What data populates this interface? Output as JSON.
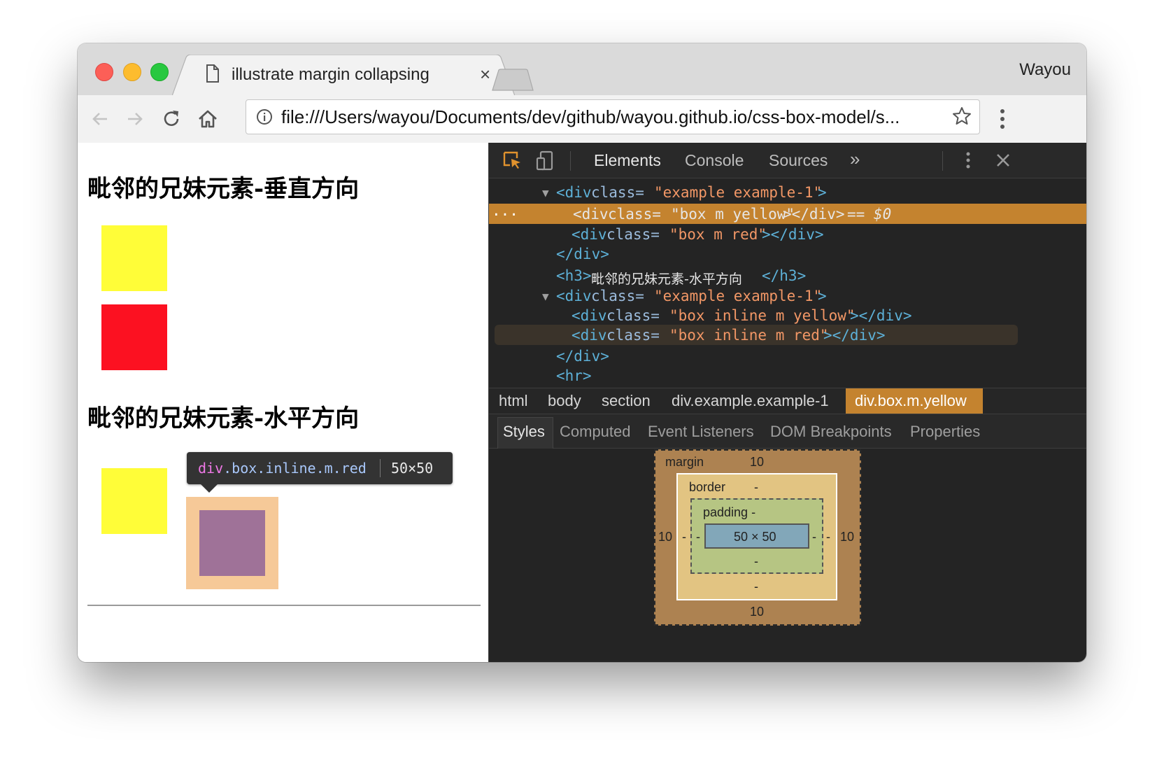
{
  "window": {
    "tab_title": "illustrate margin collapsing",
    "tab_close": "×",
    "profile_name": "Wayou"
  },
  "toolbar": {
    "url": "file:///Users/wayou/Documents/dev/github/wayou.github.io/css-box-model/s..."
  },
  "page": {
    "heading_vertical": "毗邻的兄妹元素-垂直方向",
    "heading_horizontal": "毗邻的兄妹元素-水平方向",
    "box_colors": {
      "yellow": "#fffd38",
      "red": "#fc1121"
    }
  },
  "inspector_tooltip": {
    "tag": "div",
    "classes": ".box.inline.m.red",
    "size": "50×50"
  },
  "devtools": {
    "tabs": [
      "Elements",
      "Console",
      "Sources",
      "»"
    ],
    "active_tab": "Elements",
    "dom": [
      {
        "tri": "▼",
        "open_tag": "<div",
        "attr": " class=",
        "value": "\"example example-1\"",
        "close": ">"
      },
      {
        "dots": "...",
        "open_tag": "<div",
        "attr": " class=",
        "value": "\"box m yellow\"",
        "close": "></div>",
        "tail": " == $0"
      },
      {
        "open_tag": "<div",
        "attr": " class=",
        "value": "\"box m red\"",
        "close": "></div>"
      },
      {
        "text": "</div>"
      },
      {
        "open_tag": "<h3>",
        "inner": "毗邻的兄妹元素-水平方向",
        "close": "</h3>"
      },
      {
        "tri": "▼",
        "open_tag": "<div",
        "attr": " class=",
        "value": "\"example example-1\"",
        "close": ">"
      },
      {
        "open_tag": "<div",
        "attr": " class=",
        "value": "\"box inline m yellow\"",
        "close": "></div>"
      },
      {
        "open_tag": "<div",
        "attr": " class=",
        "value": "\"box inline m red\"",
        "close": "></div>"
      },
      {
        "text": "</div>"
      },
      {
        "text": "<hr>"
      }
    ],
    "breadcrumbs": [
      "html",
      "body",
      "section",
      "div.example.example-1",
      "div.box.m.yellow"
    ],
    "sub_tabs": [
      "Styles",
      "Computed",
      "Event Listeners",
      "DOM Breakpoints",
      "Properties"
    ],
    "box_model": {
      "margin_label": "margin",
      "margin_top": "10",
      "margin_bottom": "10",
      "margin_left": "10",
      "margin_right": "10",
      "border_label": "border",
      "border_top": "-",
      "border_bottom": "-",
      "border_left": "-",
      "border_right": "-",
      "padding_label": "padding -",
      "padding_bottom": "-",
      "padding_left": "-",
      "padding_right": "-",
      "content": "50 × 50"
    }
  }
}
